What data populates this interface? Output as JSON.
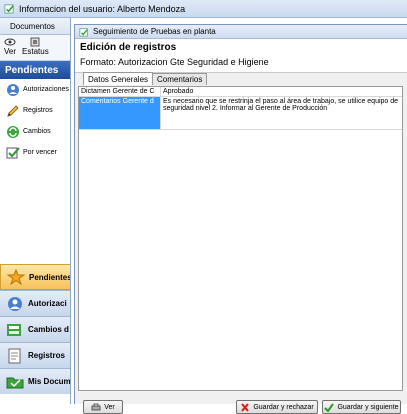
{
  "outer_window": {
    "title": "Informacion del usuario: Alberto Mendoza"
  },
  "left_pane": {
    "documents_tab": "Documentos",
    "toolbar": [
      {
        "label": "Ver",
        "icon": "eye-icon"
      },
      {
        "label": "Estatus",
        "icon": "status-icon"
      }
    ],
    "header": "Pendientes",
    "items": [
      {
        "label": "Autorizaciones",
        "icon": "authorizations-icon"
      },
      {
        "label": "Registros",
        "icon": "pencil-icon"
      },
      {
        "label": "Cambios",
        "icon": "changes-icon"
      },
      {
        "label": "Por vencer",
        "icon": "expiring-icon"
      }
    ],
    "nav": [
      {
        "label": "Pendientes",
        "icon": "star-icon",
        "active": true
      },
      {
        "label": "Autorizaci",
        "icon": "authorizations-icon"
      },
      {
        "label": "Cambios d",
        "icon": "changes-icon"
      },
      {
        "label": "Registros",
        "icon": "registry-icon"
      },
      {
        "label": "Mis Docum",
        "icon": "folder-icon"
      }
    ]
  },
  "dialog": {
    "title": "Seguimiento de Pruebas en planta",
    "heading": "Edición de registros",
    "format": "Formato:  Autorizacion Gte Seguridad e Higiene",
    "tabs": [
      "Datos Generales",
      "Comentarios"
    ],
    "rows": [
      {
        "field": "Dictamen Gerente de C",
        "value": "Aprobado",
        "selected": false
      },
      {
        "field": "Comentarios Gerente d",
        "value": "Es necesario que se restrinja el paso al área de trabajo, se utilice equipo de seguridad nivel 2. Informar al Gerente de Producción",
        "selected": true
      }
    ],
    "buttons": {
      "ver": "Ver",
      "save_reject": "Guardar y rechazar",
      "save_next": "Guardar y siguiente"
    }
  },
  "colors": {
    "accent": "#3399ff",
    "header_blue": "#1f4b9c",
    "active_nav": "#f7c25a"
  }
}
